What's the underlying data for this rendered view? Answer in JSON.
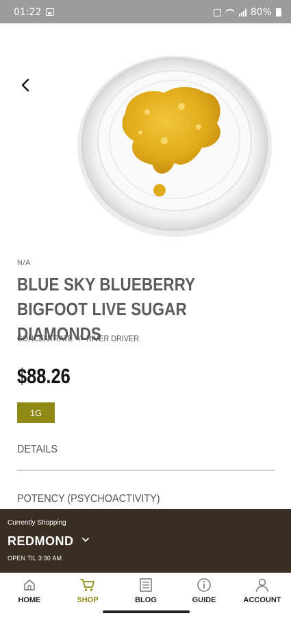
{
  "status_bar": {
    "time": "01:22",
    "battery": "80%"
  },
  "product": {
    "image_description": "jar of golden live sugar diamonds concentrate",
    "brand": "N/A",
    "title": "BLUE SKY BLUEBERRY BIGFOOT LIVE SUGAR DIAMONDS",
    "category": "CONCENTRATE",
    "breadcrumb_separator": "/",
    "producer": "RIVER DRIVER",
    "price": "$88.26",
    "size_option": "1G"
  },
  "sections": {
    "details": "DETAILS",
    "potency": "POTENCY (PSYCHOACTIVITY)"
  },
  "store": {
    "caption": "Currently Shopping",
    "name": "REDMOND",
    "hours": "OPEN TIL 3:30 AM"
  },
  "nav": {
    "items": [
      {
        "label": "HOME",
        "icon": "home-icon"
      },
      {
        "label": "SHOP",
        "icon": "cart-icon",
        "active": true
      },
      {
        "label": "BLOG",
        "icon": "blog-icon"
      },
      {
        "label": "GUIDE",
        "icon": "info-icon"
      },
      {
        "label": "ACCOUNT",
        "icon": "account-icon"
      }
    ]
  },
  "colors": {
    "accent": "#8e8a14",
    "store_bar": "#3a2e22",
    "status_bar": "#9c9c9c"
  }
}
